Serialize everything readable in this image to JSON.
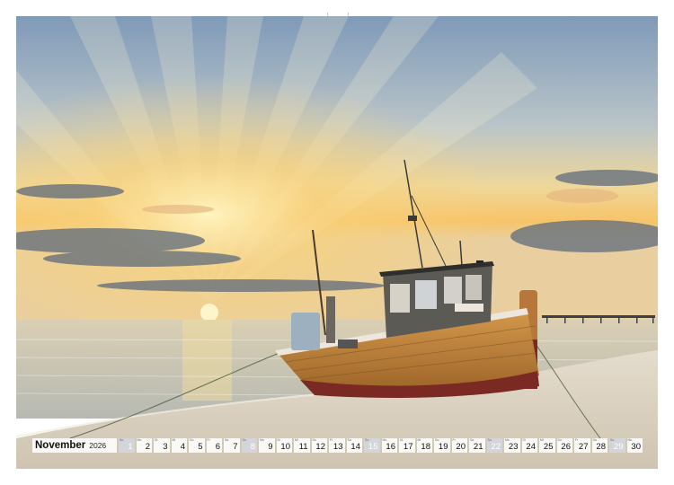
{
  "calendar": {
    "month": "November",
    "year": "2026",
    "days": [
      {
        "n": "1",
        "d": "So",
        "weekend": true
      },
      {
        "n": "2",
        "d": "Mo",
        "weekend": false
      },
      {
        "n": "3",
        "d": "Di",
        "weekend": false
      },
      {
        "n": "4",
        "d": "Mi",
        "weekend": false
      },
      {
        "n": "5",
        "d": "Do",
        "weekend": false
      },
      {
        "n": "6",
        "d": "Fr",
        "weekend": false
      },
      {
        "n": "7",
        "d": "Sa",
        "weekend": false
      },
      {
        "n": "8",
        "d": "So",
        "weekend": true
      },
      {
        "n": "9",
        "d": "Mo",
        "weekend": false
      },
      {
        "n": "10",
        "d": "Di",
        "weekend": false
      },
      {
        "n": "11",
        "d": "Mi",
        "weekend": false
      },
      {
        "n": "12",
        "d": "Do",
        "weekend": false
      },
      {
        "n": "13",
        "d": "Fr",
        "weekend": false
      },
      {
        "n": "14",
        "d": "Sa",
        "weekend": false
      },
      {
        "n": "15",
        "d": "So",
        "weekend": true
      },
      {
        "n": "16",
        "d": "Mo",
        "weekend": false
      },
      {
        "n": "17",
        "d": "Di",
        "weekend": false
      },
      {
        "n": "18",
        "d": "Mi",
        "weekend": false
      },
      {
        "n": "19",
        "d": "Do",
        "weekend": false
      },
      {
        "n": "20",
        "d": "Fr",
        "weekend": false
      },
      {
        "n": "21",
        "d": "Sa",
        "weekend": false
      },
      {
        "n": "22",
        "d": "So",
        "weekend": true
      },
      {
        "n": "23",
        "d": "Mo",
        "weekend": false
      },
      {
        "n": "24",
        "d": "Di",
        "weekend": false
      },
      {
        "n": "25",
        "d": "Mi",
        "weekend": false
      },
      {
        "n": "26",
        "d": "Do",
        "weekend": false
      },
      {
        "n": "27",
        "d": "Fr",
        "weekend": false
      },
      {
        "n": "28",
        "d": "Sa",
        "weekend": false
      },
      {
        "n": "29",
        "d": "So",
        "weekend": true
      },
      {
        "n": "30",
        "d": "Mo",
        "weekend": false
      }
    ]
  },
  "colors": {
    "sky_top": "#8aa6c4",
    "sky_glow": "#f6d27a",
    "sun": "#fff2b8",
    "sea": "#c9c3b0",
    "sand": "#ddd3c2",
    "hull_wood": "#c98a3e",
    "hull_red": "#7a2a22",
    "cabin": "#5b5a55"
  }
}
